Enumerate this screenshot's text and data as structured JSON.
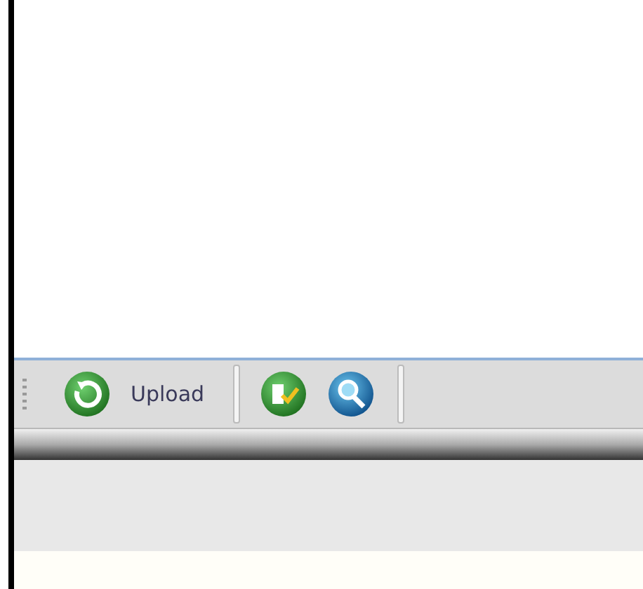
{
  "toolbar": {
    "upload_button": {
      "label": "Upload"
    }
  }
}
